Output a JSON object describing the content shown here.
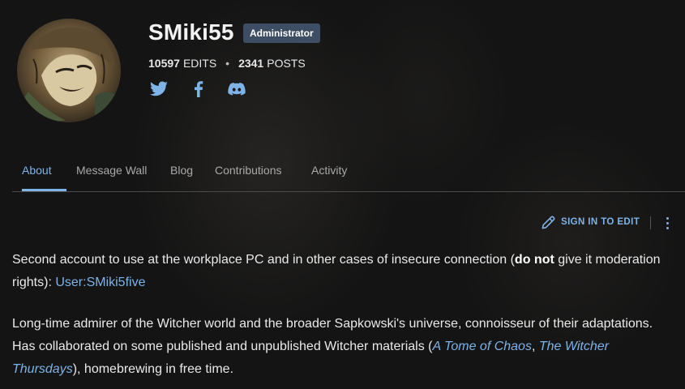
{
  "profile": {
    "username": "SMiki55",
    "role_badge": "Administrator",
    "edits_count": "10597",
    "edits_label": "EDITS",
    "separator": "•",
    "posts_count": "2341",
    "posts_label": "POSTS",
    "social_icons": [
      "twitter-icon",
      "facebook-icon",
      "discord-icon"
    ]
  },
  "tabs": [
    {
      "label": "About",
      "active": true
    },
    {
      "label": "Message Wall",
      "active": false
    },
    {
      "label": "Blog",
      "active": false
    },
    {
      "label": "Contributions",
      "active": false
    },
    {
      "label": "Activity",
      "active": false
    }
  ],
  "actions": {
    "sign_in_to_edit": "SIGN IN TO EDIT",
    "more_icon": "more-vertical-icon"
  },
  "about": {
    "p1": {
      "text_a": "Second account to use at the workplace PC and in other cases of insecure connection (",
      "bold": "do not",
      "text_b": " give it moderation rights): ",
      "link": "User:SMiki5five"
    },
    "p2": {
      "text_a": "Long-time admirer of the Witcher world and the broader Sapkowski's universe, connoisseur of their adaptations. Has collaborated on some published and unpublished Witcher materials (",
      "link1": "A Tome of Chaos",
      "sep": ", ",
      "link2": "The Witcher Thursdays",
      "text_b": "), homebrewing in free time."
    }
  },
  "colors": {
    "accent": "#7eb3e8",
    "background": "#151515",
    "badge": "#3d4d63",
    "text": "#eaeaea",
    "muted": "#a9a9a9"
  }
}
